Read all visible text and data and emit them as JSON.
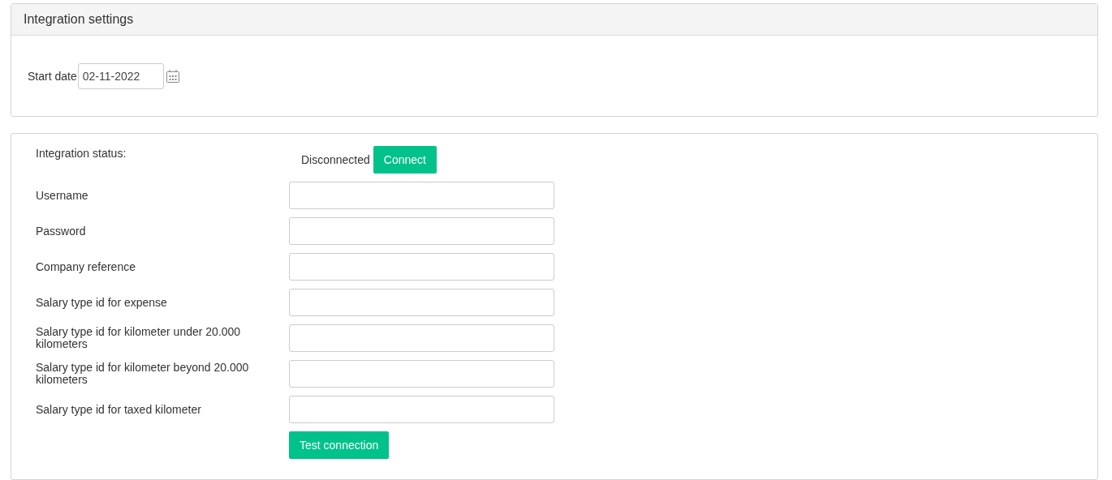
{
  "settings_panel": {
    "title": "Integration settings",
    "start_date": {
      "label": "Start date",
      "value": "02-11-2022"
    }
  },
  "integration_panel": {
    "rows": [
      {
        "kind": "status",
        "label": "Integration status:",
        "status": "Disconnected",
        "button": "Connect"
      },
      {
        "kind": "input",
        "label": "Username"
      },
      {
        "kind": "input",
        "label": "Password"
      },
      {
        "kind": "input",
        "label": "Company reference"
      },
      {
        "kind": "input",
        "label": "Salary type id for expense"
      },
      {
        "kind": "input",
        "label": "Salary type id for kilometer under 20.000 kilometers"
      },
      {
        "kind": "input",
        "label": "Salary type id for kilometer beyond 20.000 kilometers"
      },
      {
        "kind": "input",
        "label": "Salary type id for taxed kilometer"
      }
    ],
    "test_button": "Test connection"
  }
}
